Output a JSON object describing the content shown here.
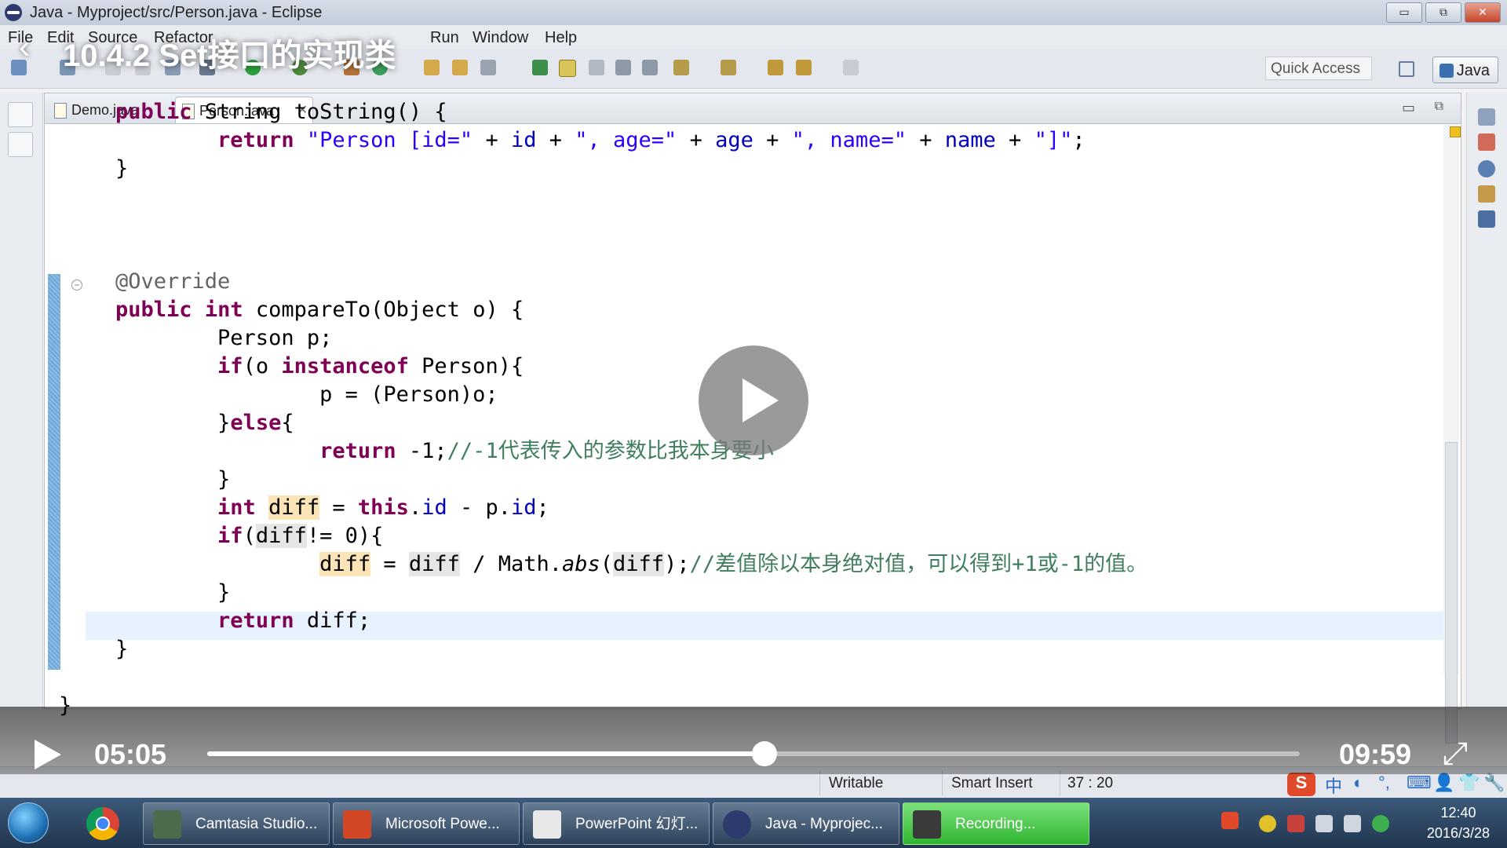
{
  "window": {
    "title": "Java - Myproject/src/Person.java - Eclipse",
    "controls": [
      "▭",
      "⧉",
      "✕"
    ]
  },
  "video": {
    "title": "10.4.2  Set接口的实现类",
    "back_icon": "‹",
    "current_time": "05:05",
    "total_time": "09:59",
    "progress": 0.51
  },
  "menu": [
    "File",
    "Edit",
    "Source",
    "Refactor",
    "Run",
    "Window",
    "Help"
  ],
  "toolbar": {
    "quick_access": "Quick Access",
    "perspective": "Java"
  },
  "tabs": [
    {
      "label": "Demo.java",
      "active": false
    },
    {
      "label": "Person.java",
      "active": true,
      "close": "✕"
    }
  ],
  "editor_controls": {
    "minimize": "▭",
    "maximize": "⧉"
  },
  "code_lines": [
    "    public String toString() {",
    "        return \"Person [id=\" + id + \", age=\" + age + \", name=\" + name + \"]\";",
    "    }",
    "",
    "",
    "",
    "    @Override",
    "    public int compareTo(Object o) {",
    "        Person p;",
    "        if(o instanceof Person){",
    "            p = (Person)o;",
    "        }else{",
    "            return -1;//-1代表传入的参数比我本身要小",
    "        }",
    "        int diff = this.id - p.id;",
    "        if(diff!= 0){",
    "            diff = diff / Math.abs(diff);//差值除以本身绝对值，可以得到+1或-1的值。",
    "        }",
    "        return diff;",
    "    }",
    "",
    "}"
  ],
  "code_html": [
    "<span class=\"kw\">public</span> String toString() {",
    "    <span class=\"kw\">return</span> <span class=\"str\">\"Person [id=\"</span> + <span class=\"fld\">id</span> + <span class=\"str\">\", age=\"</span> + <span class=\"fld\">age</span> + <span class=\"str\">\", name=\"</span> + <span class=\"fld\">name</span> + <span class=\"str\">\"]\"</span>;",
    "}",
    "",
    "",
    "",
    "<span class=\"ann\">@Override</span>",
    "<span class=\"kw\">public</span> <span class=\"kw\">int</span> compareTo(Object o) {",
    "    Person p;",
    "    <span class=\"kw\">if</span>(o <span class=\"kw\">instanceof</span> Person){",
    "        p = (Person)o;",
    "    }<span class=\"kw\">else</span>{",
    "        <span class=\"kw\">return</span> -1;<span class=\"cmt\">//-1代表传入的参数比我本身要小</span>",
    "    }",
    "    <span class=\"kw\">int</span> <span class=\"hl-w\">diff</span> = <span class=\"kw\">this</span>.<span class=\"fld\">id</span> - p.<span class=\"fld\">id</span>;",
    "    <span class=\"kw\">if</span>(<span class=\"hl-r\">diff</span>!= 0){",
    "        <span class=\"hl-w\">diff</span> = <span class=\"hl-r\">diff</span> / Math.<span class=\"it\">abs</span>(<span class=\"hl-r\">diff</span>);<span class=\"cmt\">//差值除以本身绝对值，可以得到+1或-1的值。</span>",
    "    }",
    "    <span class=\"kw\">return</span> diff;",
    "}",
    "",
    "}"
  ],
  "status": {
    "writable": "Writable",
    "insert_mode": "Smart Insert",
    "position": "37 : 20"
  },
  "ime": [
    "中",
    "◐",
    "°,",
    "⌨",
    "👤",
    "👕",
    "🔧"
  ],
  "taskbar": {
    "items": [
      {
        "label": "Camtasia Studio...",
        "color": "#4d6b4d"
      },
      {
        "label": "Microsoft Powe...",
        "color": "#d24726"
      },
      {
        "label": "PowerPoint 幻灯...",
        "color": "#e8e8e8"
      },
      {
        "label": "Java - Myprojec...",
        "color": "#2e3a6e"
      },
      {
        "label": "Recording...",
        "color": "#3a3a3a"
      }
    ],
    "time": "12:40",
    "date": "2016/3/28"
  }
}
